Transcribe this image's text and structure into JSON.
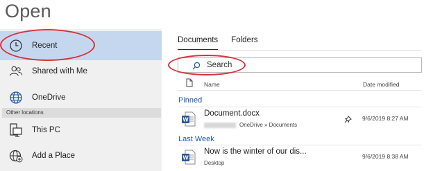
{
  "page": {
    "title": "Open"
  },
  "nav": {
    "recent": "Recent",
    "shared": "Shared with Me",
    "onedrive": "OneDrive",
    "other_locations": "Other locations",
    "this_pc": "This PC",
    "add_place": "Add a Place"
  },
  "tabs": {
    "documents": "Documents",
    "folders": "Folders",
    "active": "Documents"
  },
  "search": {
    "placeholder": "Search"
  },
  "list": {
    "col_name": "Name",
    "col_date": "Date modified",
    "sections": [
      {
        "title": "Pinned",
        "items": [
          {
            "name": "Document.docx",
            "path": "OneDrive » Documents",
            "date": "9/6/2019 8:27 AM",
            "pinned": true
          }
        ]
      },
      {
        "title": "Last Week",
        "items": [
          {
            "name": "Now is the winter of our dis...",
            "path": "Desktop",
            "date": "9/6/2019 8:38 AM",
            "pinned": false
          }
        ]
      }
    ]
  },
  "colors": {
    "accent": "#1f5aa8",
    "selected": "#c5d7ef",
    "annotation": "#d2343a",
    "word_blue": "#2b579a"
  }
}
